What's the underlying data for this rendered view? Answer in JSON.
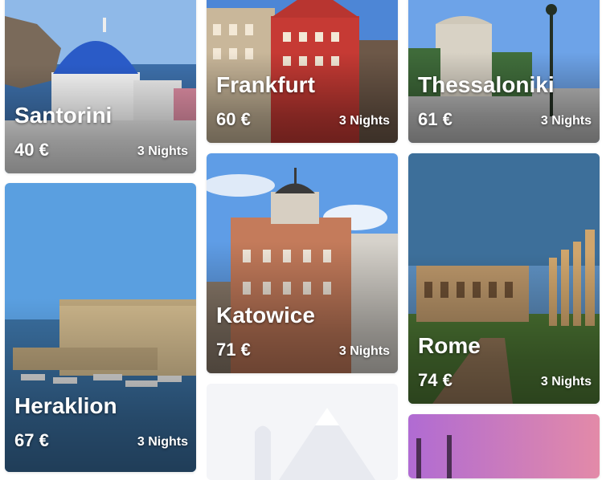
{
  "destinations": [
    {
      "city": "Santorini",
      "price": "40 €",
      "nights": "3 Nights"
    },
    {
      "city": "Frankfurt",
      "price": "60 €",
      "nights": "3 Nights"
    },
    {
      "city": "Thessaloniki",
      "price": "61 €",
      "nights": "3 Nights"
    },
    {
      "city": "Heraklion",
      "price": "67 €",
      "nights": "3 Nights"
    },
    {
      "city": "Katowice",
      "price": "71 €",
      "nights": "3 Nights"
    },
    {
      "city": "Rome",
      "price": "74 €",
      "nights": "3 Nights"
    }
  ],
  "colors": {
    "text": "#ffffff",
    "placeholder_bg": "#f4f5f8",
    "sky": "#5a9fe0"
  }
}
